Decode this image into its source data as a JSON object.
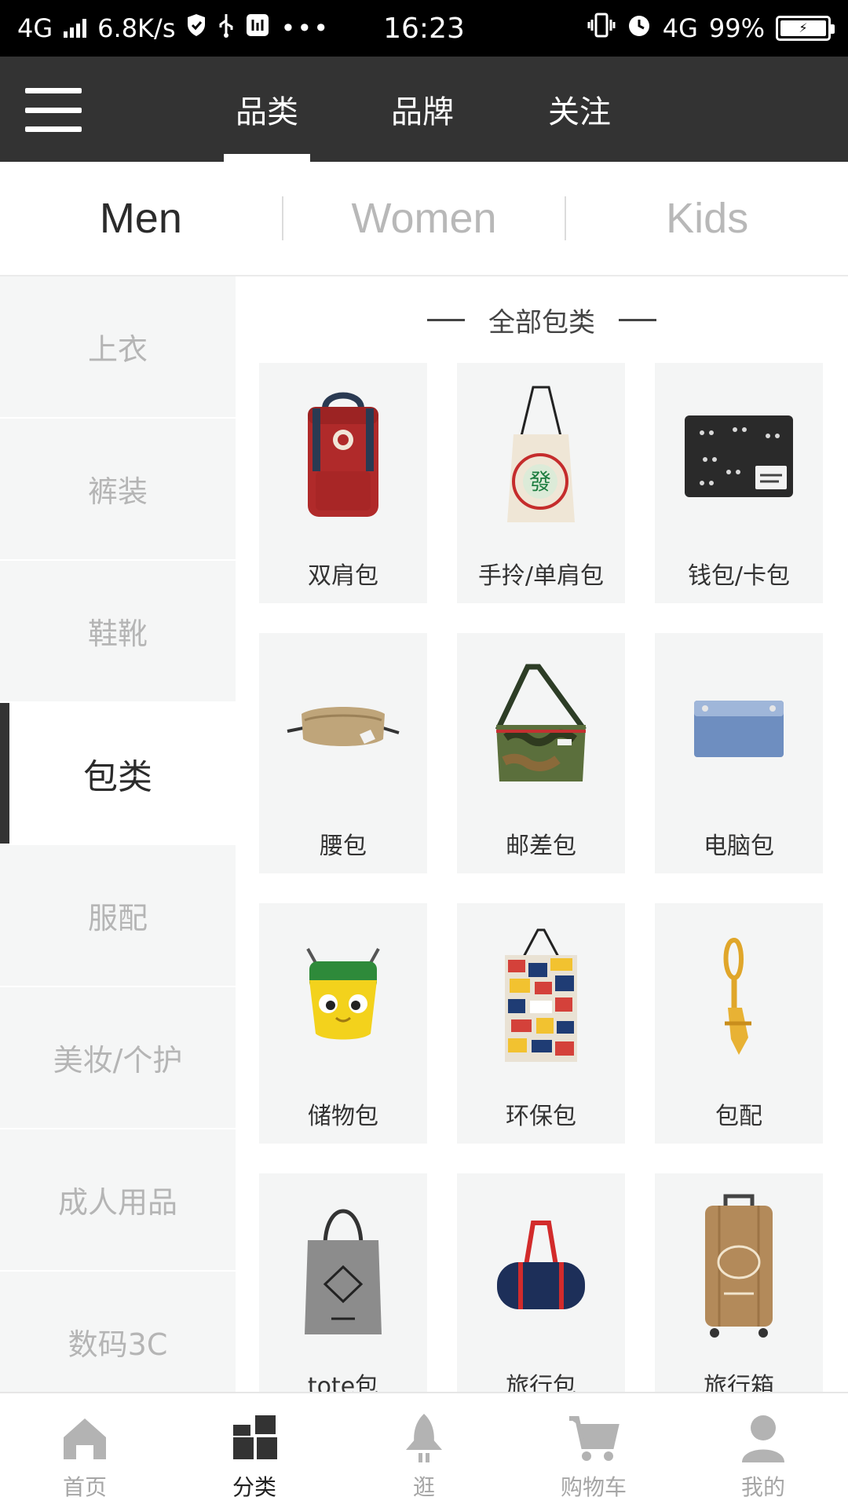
{
  "status_bar": {
    "network": "4G",
    "speed": "6.8K/s",
    "time": "16:23",
    "network_right": "4G",
    "battery": "99%"
  },
  "header": {
    "tabs": [
      {
        "label": "品类",
        "active": true
      },
      {
        "label": "品牌",
        "active": false
      },
      {
        "label": "关注",
        "active": false
      }
    ]
  },
  "gender_tabs": [
    {
      "label": "Men",
      "active": true
    },
    {
      "label": "Women",
      "active": false
    },
    {
      "label": "Kids",
      "active": false
    }
  ],
  "sidebar": {
    "items": [
      {
        "label": "上衣"
      },
      {
        "label": "裤装"
      },
      {
        "label": "鞋靴"
      },
      {
        "label": "包类",
        "active": true
      },
      {
        "label": "服配"
      },
      {
        "label": "美妆/个护"
      },
      {
        "label": "成人用品"
      },
      {
        "label": "数码3C"
      }
    ]
  },
  "main": {
    "section_title": "全部包类",
    "products": [
      {
        "label": "双肩包",
        "icon": "backpack-icon"
      },
      {
        "label": "手拎/单肩包",
        "icon": "tote-bag-icon"
      },
      {
        "label": "钱包/卡包",
        "icon": "wallet-icon"
      },
      {
        "label": "腰包",
        "icon": "waist-bag-icon"
      },
      {
        "label": "邮差包",
        "icon": "messenger-bag-icon"
      },
      {
        "label": "电脑包",
        "icon": "laptop-sleeve-icon"
      },
      {
        "label": "储物包",
        "icon": "pouch-icon"
      },
      {
        "label": "环保包",
        "icon": "shopping-bag-icon"
      },
      {
        "label": "包配",
        "icon": "carabiner-icon"
      },
      {
        "label": "tote包",
        "icon": "canvas-tote-icon"
      },
      {
        "label": "旅行包",
        "icon": "duffel-bag-icon"
      },
      {
        "label": "旅行箱",
        "icon": "suitcase-icon"
      }
    ]
  },
  "bottom_nav": {
    "items": [
      {
        "label": "首页",
        "icon": "home-icon"
      },
      {
        "label": "分类",
        "icon": "category-icon",
        "active": true
      },
      {
        "label": "逛",
        "icon": "rocket-icon"
      },
      {
        "label": "购物车",
        "icon": "cart-icon"
      },
      {
        "label": "我的",
        "icon": "user-icon"
      }
    ]
  },
  "colors": {
    "header_bg": "#333333",
    "sidebar_bg": "#f5f6f6",
    "card_bg": "#f4f5f5",
    "active_text": "#2b2b2b",
    "inactive_text": "#b5b5b5"
  }
}
